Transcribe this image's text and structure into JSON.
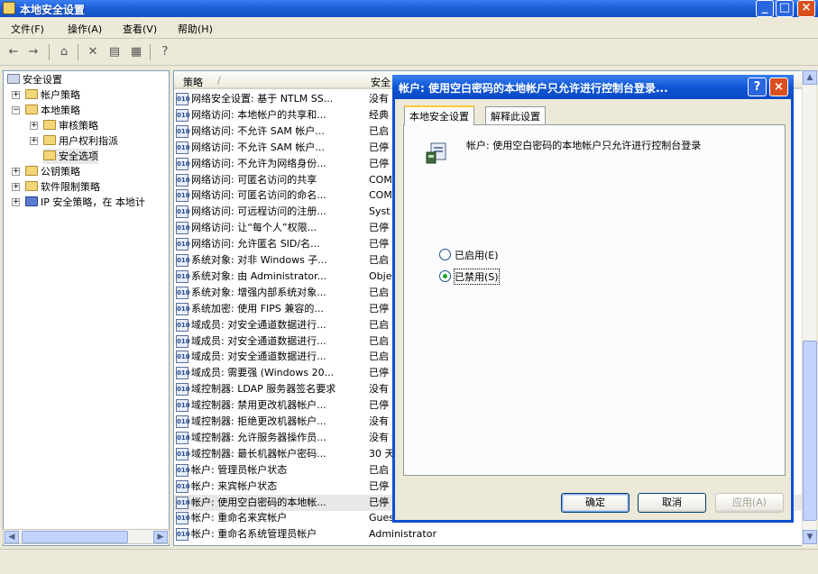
{
  "window": {
    "title": "本地安全设置"
  },
  "menu": [
    "文件(F)",
    "操作(A)",
    "查看(V)",
    "帮助(H)"
  ],
  "toolbar_icons": [
    "back-icon",
    "forward-icon",
    "up-folder-icon",
    "delete-icon",
    "properties-icon",
    "export-icon",
    "help-icon"
  ],
  "tree": [
    {
      "label": "安全设置",
      "level": 0,
      "icon": "shield-icon",
      "expander": ""
    },
    {
      "label": "帐户策略",
      "level": 1,
      "icon": "folder-icon",
      "expander": "+"
    },
    {
      "label": "本地策略",
      "level": 1,
      "icon": "folder-icon",
      "expander": "-"
    },
    {
      "label": "审核策略",
      "level": 2,
      "icon": "folder-icon",
      "expander": "+"
    },
    {
      "label": "用户权利指派",
      "level": 2,
      "icon": "folder-icon",
      "expander": "+"
    },
    {
      "label": "安全选项",
      "level": 2,
      "icon": "folder-icon",
      "expander": "",
      "selected": true
    },
    {
      "label": "公钥策略",
      "level": 1,
      "icon": "folder-icon",
      "expander": "+"
    },
    {
      "label": "软件限制策略",
      "level": 1,
      "icon": "folder-icon",
      "expander": "+"
    },
    {
      "label": "IP 安全策略，在 本地计",
      "level": 1,
      "icon": "ip-policy-icon",
      "expander": "+"
    }
  ],
  "list": {
    "columns": [
      "策略",
      "安全"
    ],
    "rows": [
      {
        "name": "网络安全设置: 基于 NTLM SS...",
        "value": "没有"
      },
      {
        "name": "网络访问: 本地帐户的共享和...",
        "value": "经典"
      },
      {
        "name": "网络访问: 不允许 SAM 帐户...",
        "value": "已启"
      },
      {
        "name": "网络访问: 不允许 SAM 帐户...",
        "value": "已停"
      },
      {
        "name": "网络访问: 不允许为网络身份...",
        "value": "已停"
      },
      {
        "name": "网络访问: 可匿名访问的共享",
        "value": "COMC"
      },
      {
        "name": "网络访问: 可匿名访问的命名...",
        "value": "COMN"
      },
      {
        "name": "网络访问: 可远程访问的注册...",
        "value": "Syst"
      },
      {
        "name": "网络访问: 让“每个人”权限...",
        "value": "已停"
      },
      {
        "name": "网络访问: 允许匿名 SID/名...",
        "value": "已停"
      },
      {
        "name": "系统对象: 对非 Windows 子...",
        "value": "已启"
      },
      {
        "name": "系统对象: 由 Administrator...",
        "value": "Obje"
      },
      {
        "name": "系统对象: 增强内部系统对象...",
        "value": "已启"
      },
      {
        "name": "系统加密: 使用 FIPS 兼容的...",
        "value": "已停"
      },
      {
        "name": "域成员: 对安全通道数据进行...",
        "value": "已启"
      },
      {
        "name": "域成员: 对安全通道数据进行...",
        "value": "已启"
      },
      {
        "name": "域成员: 对安全通道数据进行...",
        "value": "已启"
      },
      {
        "name": "域成员: 需要强 (Windows 20...",
        "value": "已停"
      },
      {
        "name": "域控制器: LDAP 服务器签名要求",
        "value": "没有"
      },
      {
        "name": "域控制器: 禁用更改机器帐户...",
        "value": "已停"
      },
      {
        "name": "域控制器: 拒绝更改机器帐户...",
        "value": "没有"
      },
      {
        "name": "域控制器: 允许服务器操作员...",
        "value": "没有"
      },
      {
        "name": "域控制器: 最长机器帐户密码...",
        "value": "30 天"
      },
      {
        "name": "帐户: 管理员帐户状态",
        "value": "已启"
      },
      {
        "name": "帐户: 来宾帐户状态",
        "value": "已停"
      },
      {
        "name": "帐户: 使用空白密码的本地帐...",
        "value": "已停"
      },
      {
        "name": "帐户: 重命名来宾帐户",
        "value": "Guest"
      },
      {
        "name": "帐户: 重命名系统管理员帐户",
        "value": "Administrator"
      }
    ]
  },
  "dialog": {
    "title": "帐户: 使用空白密码的本地帐户只允许进行控制台登录...",
    "tabs": [
      "本地安全设置",
      "解释此设置"
    ],
    "policy_name": "帐户: 使用空白密码的本地帐户只允许进行控制台登录",
    "options": [
      {
        "label": "已启用(E)",
        "checked": false
      },
      {
        "label": "已禁用(S)",
        "checked": true
      }
    ],
    "buttons": {
      "ok": "确定",
      "cancel": "取消",
      "apply": "应用(A)"
    }
  }
}
